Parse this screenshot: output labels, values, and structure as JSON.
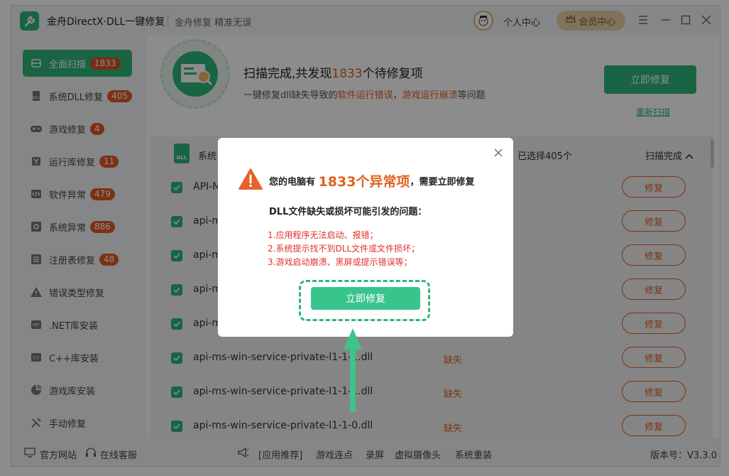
{
  "app": {
    "title": "金舟DirectX·DLL一键修复",
    "subtitle": "金舟修复 精准无误",
    "user_center": "个人中心",
    "vip_label": "会员中心",
    "accent_color": "#2fb679",
    "warning_color": "#e0621f"
  },
  "sidebar": {
    "items": [
      {
        "label": "全面扫描",
        "badge": "1833",
        "icon": "scan-icon"
      },
      {
        "label": "系统DLL修复",
        "badge": "405",
        "icon": "dll-icon"
      },
      {
        "label": "游戏修复",
        "badge": "4",
        "icon": "gamepad-icon"
      },
      {
        "label": "运行库修复",
        "badge": "11",
        "icon": "runtime-icon"
      },
      {
        "label": "软件异常",
        "badge": "479",
        "icon": "code-icon"
      },
      {
        "label": "系统异常",
        "badge": "886",
        "icon": "gear-icon"
      },
      {
        "label": "注册表修复",
        "badge": "48",
        "icon": "registry-icon"
      },
      {
        "label": "错误类型修复",
        "badge": "",
        "icon": "warning-icon"
      },
      {
        "label": ".NET库安装",
        "badge": "",
        "icon": "net-icon"
      },
      {
        "label": "C++库安装",
        "badge": "",
        "icon": "cpp-icon"
      },
      {
        "label": "游戏库安装",
        "badge": "",
        "icon": "pie-icon"
      },
      {
        "label": "手动修复",
        "badge": "",
        "icon": "tools-icon"
      }
    ]
  },
  "scan": {
    "title_prefix": "扫描完成,共发现",
    "count": "1833",
    "title_suffix": "个待修复项",
    "desc_prefix": "一键修复dll缺失导致的",
    "desc_hl1": "软件运行错误",
    "desc_sep": "，",
    "desc_hl2": "游戏运行崩溃",
    "desc_suffix": "等问题",
    "fix_now": "立即修复",
    "rescan": "重新扫描"
  },
  "list": {
    "category": "系统",
    "selected_prefix": "已选择",
    "selected_count": "405",
    "selected_suffix": "个",
    "scan_state": "扫描完成",
    "rows": [
      {
        "name": "API-M",
        "status": "",
        "action": "修复"
      },
      {
        "name": "api-m",
        "status": "",
        "action": "修复"
      },
      {
        "name": "api-m",
        "status": "",
        "action": "修复"
      },
      {
        "name": "api-m",
        "status": "",
        "action": "修复"
      },
      {
        "name": "api-m",
        "status": "",
        "action": "修复"
      },
      {
        "name": "api-ms-win-service-private-l1-1-1.dll",
        "status": "缺失",
        "action": "修复"
      },
      {
        "name": "api-ms-win-service-private-l1-1-1.dll",
        "status": "缺失",
        "action": "修复"
      },
      {
        "name": "api-ms-win-service-private-l1-1-0.dll",
        "status": "缺失",
        "action": "修复"
      }
    ]
  },
  "footer": {
    "website": "官方网站",
    "support": "在线客服",
    "links": [
      "[应用推荐]",
      "游戏连点",
      "录屏",
      "虚拟摄像头",
      "系统重装"
    ],
    "version": "版本号：V3.3.0"
  },
  "modal": {
    "headline_prefix": "您的电脑有",
    "headline_big": "1833个异常项",
    "headline_suffix": "，需要立即修复",
    "subtitle": "DLL文件缺失或损坏可能引发的问题：",
    "reasons": [
      "1.应用程序无法启动、报错；",
      "2.系统提示找不到DLL文件或文件损坏；",
      "3.游戏启动崩溃、黑屏或提示错误等；"
    ],
    "button": "立即修复"
  }
}
